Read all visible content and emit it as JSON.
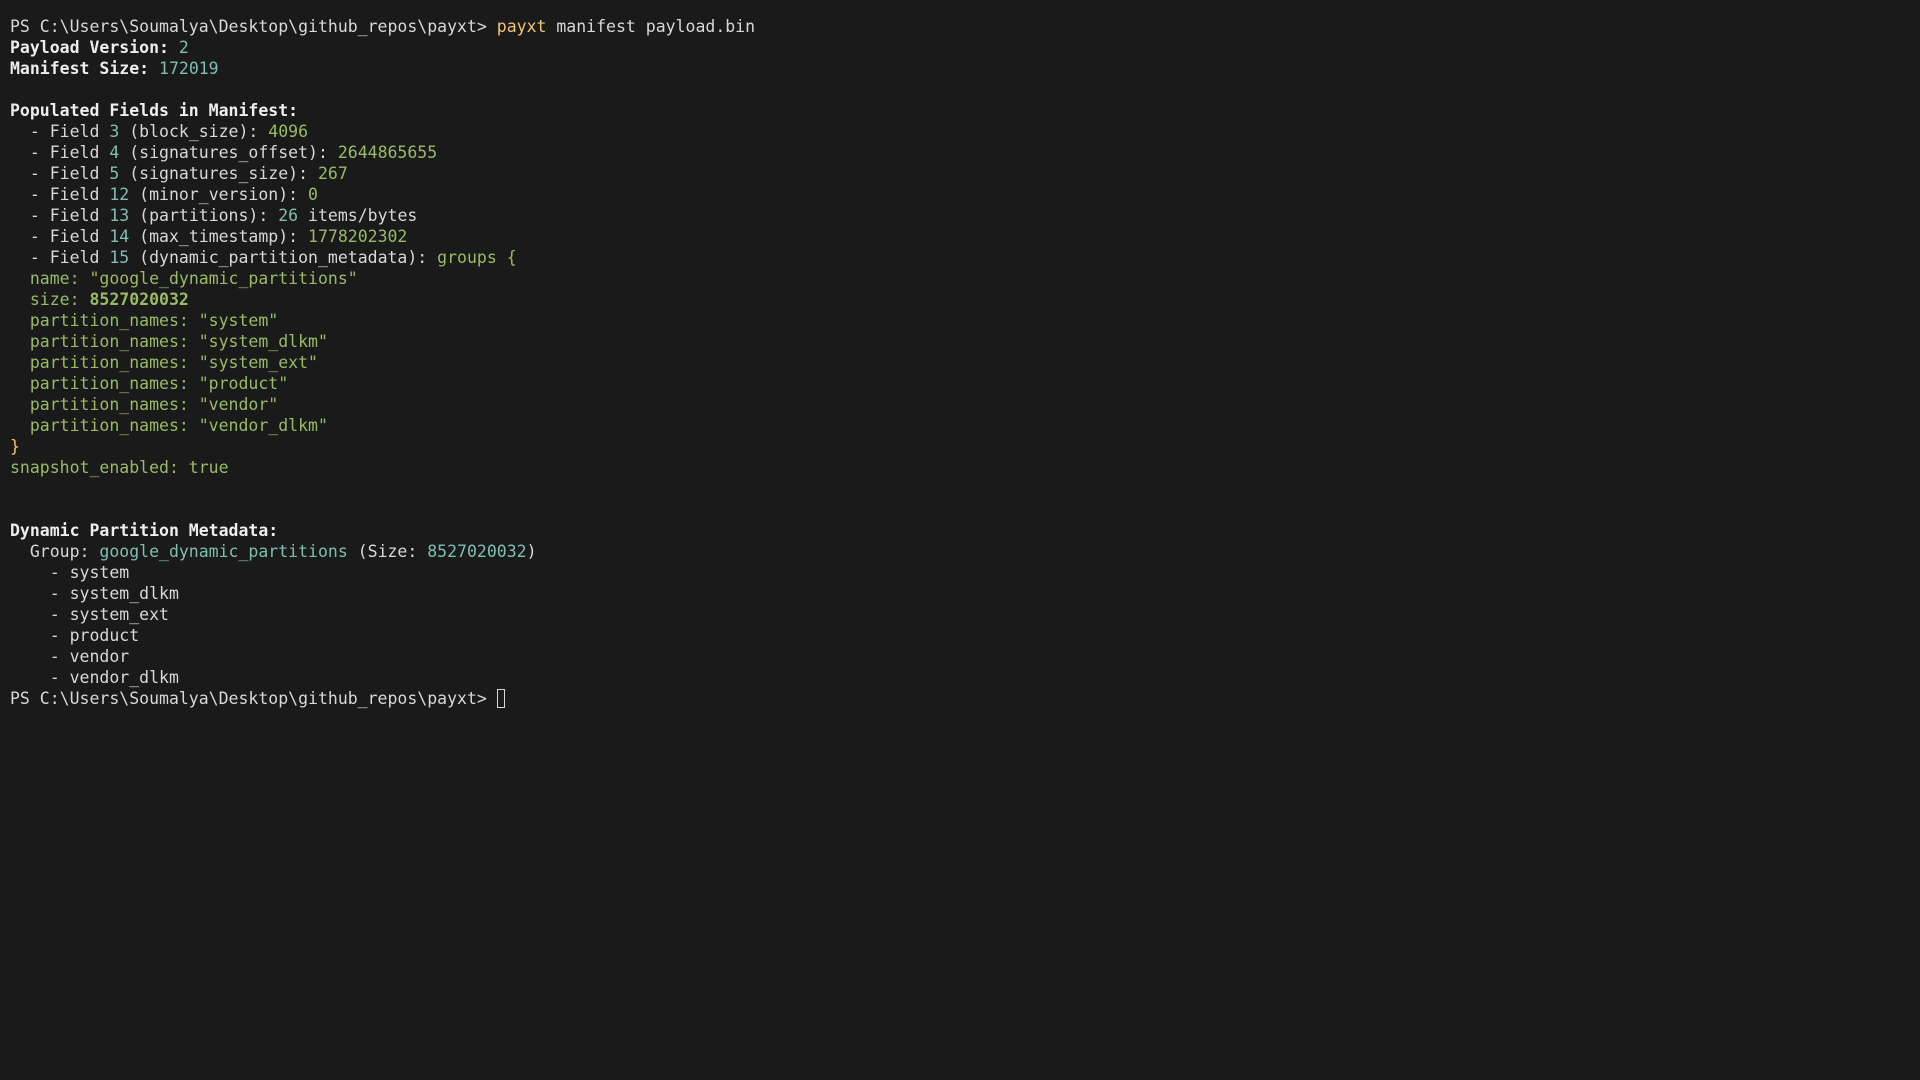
{
  "colors": {
    "background": "#1a1a1a",
    "text": "#d8d8d8",
    "number": "#7fbfb0",
    "command": "#f0c674",
    "value": "#99bb66"
  },
  "prompt": "PS C:\\Users\\Soumalya\\Desktop\\github_repos\\payxt> ",
  "command": {
    "program": "payxt",
    "args": " manifest payload.bin"
  },
  "header": {
    "payload_version_label": "Payload Version: ",
    "payload_version": "2",
    "manifest_size_label": "Manifest Size: ",
    "manifest_size": "172019"
  },
  "populated": {
    "title": "Populated Fields in Manifest:",
    "fields": [
      {
        "prefix": "  - Field ",
        "num": "3",
        "name": " (block_size): ",
        "value": "4096",
        "suffix": ""
      },
      {
        "prefix": "  - Field ",
        "num": "4",
        "name": " (signatures_offset): ",
        "value": "2644865655",
        "suffix": ""
      },
      {
        "prefix": "  - Field ",
        "num": "5",
        "name": " (signatures_size): ",
        "value": "267",
        "suffix": ""
      },
      {
        "prefix": "  - Field ",
        "num": "12",
        "name": " (minor_version): ",
        "value": "0",
        "suffix": ""
      },
      {
        "prefix": "  - Field ",
        "num": "13",
        "name": " (partitions): ",
        "value": "26",
        "suffix": " items/bytes"
      },
      {
        "prefix": "  - Field ",
        "num": "14",
        "name": " (max_timestamp): ",
        "value": "1778202302",
        "suffix": ""
      }
    ],
    "field15": {
      "prefix": "  - Field ",
      "num": "15",
      "name": " (dynamic_partition_metadata): ",
      "value": "groups {"
    },
    "group_name_label": "  name: ",
    "group_name_value": "\"google_dynamic_partitions\"",
    "group_size_label": "  size: ",
    "group_size_value": "8527020032",
    "partition_names": [
      "  partition_names: \"system\"",
      "  partition_names: \"system_dlkm\"",
      "  partition_names: \"system_ext\"",
      "  partition_names: \"product\"",
      "  partition_names: \"vendor\"",
      "  partition_names: \"vendor_dlkm\""
    ],
    "closing_brace": "}",
    "snapshot_line": "snapshot_enabled: true"
  },
  "dynamic": {
    "title": "Dynamic Partition Metadata:",
    "group_label": "  Group: ",
    "group_name": "google_dynamic_partitions",
    "size_open": " (Size: ",
    "size_value": "8527020032",
    "size_close": ")",
    "partitions": [
      "    - system",
      "    - system_dlkm",
      "    - system_ext",
      "    - product",
      "    - vendor",
      "    - vendor_dlkm"
    ]
  }
}
